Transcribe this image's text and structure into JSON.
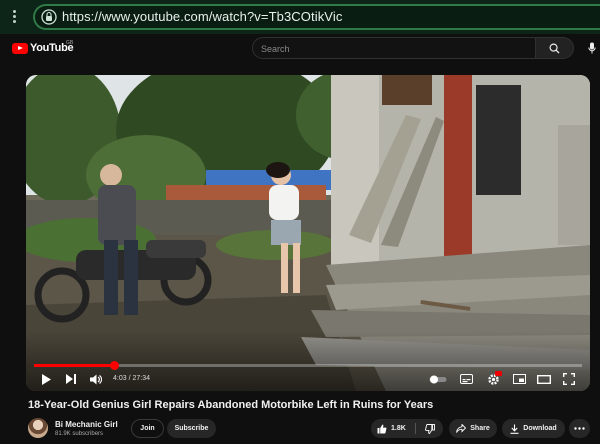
{
  "browser": {
    "url": "https://www.youtube.com/watch?v=Tb3COtikVic"
  },
  "header": {
    "logo_text": "YouTube",
    "region": "GB",
    "search_placeholder": "Search"
  },
  "player": {
    "time_display": "4:03 / 27:34",
    "progress_fraction": 0.146,
    "icons": [
      "play-icon",
      "next-icon",
      "volume-icon",
      "autoplay-toggle-icon",
      "subtitles-icon",
      "settings-icon",
      "miniplayer-icon",
      "theater-icon",
      "fullscreen-icon"
    ]
  },
  "video": {
    "title": "18-Year-Old Genius Girl Repairs Abandoned Motorbike Left in Ruins for Years"
  },
  "channel": {
    "name": "Bi Mechanic Girl",
    "subscribers": "81.9K subscribers",
    "join_label": "Join",
    "subscribe_label": "Subscribe"
  },
  "actions": {
    "like_count": "1.8K",
    "share_label": "Share",
    "download_label": "Download"
  },
  "colors": {
    "brand_red": "#ff0000",
    "browser_green": "#2f7a45",
    "page_bg": "#0f0f0f",
    "pill_bg": "#272727"
  }
}
